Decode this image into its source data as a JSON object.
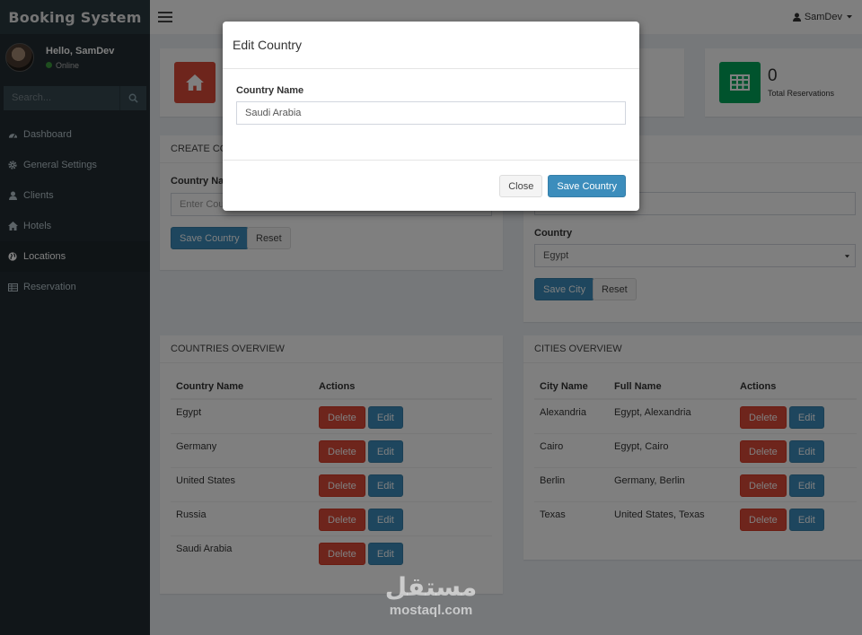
{
  "app": {
    "brand": "Booking System"
  },
  "user": {
    "greeting": "Hello, SamDev",
    "status": "Online",
    "menu_name": "SamDev"
  },
  "sidebar": {
    "search_placeholder": "Search...",
    "items": [
      {
        "label": "Dashboard",
        "icon": "dashboard-icon"
      },
      {
        "label": "General Settings",
        "icon": "gear-icon"
      },
      {
        "label": "Clients",
        "icon": "user-icon"
      },
      {
        "label": "Hotels",
        "icon": "home-icon"
      },
      {
        "label": "Locations",
        "icon": "globe-icon",
        "active": true
      },
      {
        "label": "Reservation",
        "icon": "table-icon"
      }
    ]
  },
  "stats": {
    "reservations_count": "0",
    "reservations_label": "Total Reservations",
    "colors": {
      "red": "#dd4b39",
      "green": "#00a65a"
    }
  },
  "create_country": {
    "title": "CREATE CO",
    "field_label": "Country Na",
    "placeholder": "Enter Cou",
    "save_label": "Save Country",
    "reset_label": "Reset"
  },
  "create_city": {
    "country_label": "Country",
    "country_value": "Egypt",
    "save_label": "Save City",
    "reset_label": "Reset"
  },
  "countries_overview": {
    "title": "COUNTRIES OVERVIEW",
    "col_name": "Country Name",
    "col_actions": "Actions",
    "delete_label": "Delete",
    "edit_label": "Edit",
    "rows": [
      "Egypt",
      "Germany",
      "United States",
      "Russia",
      "Saudi Arabia"
    ]
  },
  "cities_overview": {
    "title": "CITIES OVERVIEW",
    "col_city": "City Name",
    "col_full": "Full Name",
    "col_actions": "Actions",
    "delete_label": "Delete",
    "edit_label": "Edit",
    "rows": [
      {
        "city": "Alexandria",
        "full": "Egypt, Alexandria"
      },
      {
        "city": "Cairo",
        "full": "Egypt, Cairo"
      },
      {
        "city": "Berlin",
        "full": "Germany, Berlin"
      },
      {
        "city": "Texas",
        "full": "United States, Texas"
      }
    ]
  },
  "modal": {
    "title": "Edit Country",
    "field_label": "Country Name",
    "field_value": "Saudi Arabia",
    "close_label": "Close",
    "save_label": "Save Country"
  },
  "watermark": {
    "arabic": "مستقل",
    "latin": "mostaql.com"
  }
}
